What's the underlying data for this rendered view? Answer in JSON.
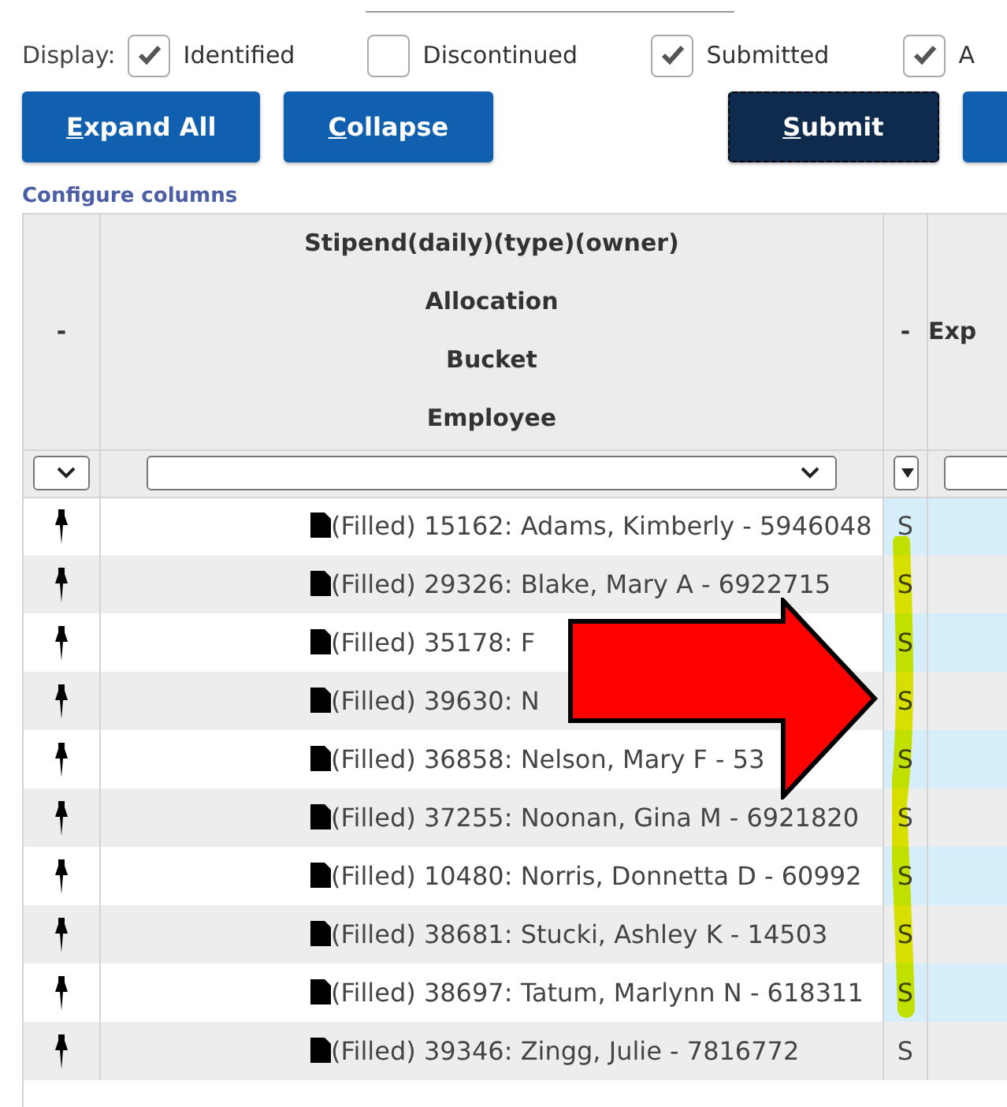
{
  "display": {
    "label": "Display:",
    "options": [
      {
        "label": "Identified",
        "checked": true
      },
      {
        "label": "Discontinued",
        "checked": false
      },
      {
        "label": "Submitted",
        "checked": true
      },
      {
        "label": "A",
        "checked": true
      }
    ]
  },
  "buttons": [
    {
      "key": "E",
      "rest": "xpand All",
      "focused": false
    },
    {
      "key": "C",
      "rest": "ollapse",
      "focused": false
    },
    {
      "key": "S",
      "rest": "ubmit",
      "focused": true
    },
    {
      "kind": "stub"
    }
  ],
  "configure_link": "Configure columns",
  "table": {
    "columns": [
      {
        "heading_lines": [
          "-"
        ],
        "filter": {
          "kind": "select"
        }
      },
      {
        "heading_lines": [
          "Stipend(daily)(type)(owner)",
          "Allocation",
          "Bucket",
          "Employee"
        ],
        "filter": {
          "kind": "select"
        }
      },
      {
        "heading_lines": [
          "-"
        ],
        "filter": {
          "kind": "combo"
        }
      },
      {
        "heading_lines": [
          "Exp"
        ],
        "filter": {
          "kind": "input"
        }
      }
    ],
    "rows": [
      {
        "employee": "(Filled) 15162: Adams, Kimberly - 5946048",
        "status": "S"
      },
      {
        "employee": "(Filled) 29326: Blake, Mary A - 6922715",
        "status": "S"
      },
      {
        "employee": "(Filled) 35178: F",
        "status": "S"
      },
      {
        "employee": "(Filled) 39630: N",
        "status": "S"
      },
      {
        "employee": "(Filled) 36858: Nelson, Mary F - 53",
        "status": "S"
      },
      {
        "employee": "(Filled) 37255: Noonan, Gina M - 6921820",
        "status": "S"
      },
      {
        "employee": "(Filled) 10480: Norris, Donnetta D - 60992",
        "status": "S"
      },
      {
        "employee": "(Filled) 38681: Stucki, Ashley K - 14503",
        "status": "S"
      },
      {
        "employee": "(Filled) 38697: Tatum, Marlynn N - 618311",
        "status": "S"
      },
      {
        "employee": "(Filled) 39346: Zingg, Julie - 7816772",
        "status": "S"
      }
    ]
  }
}
